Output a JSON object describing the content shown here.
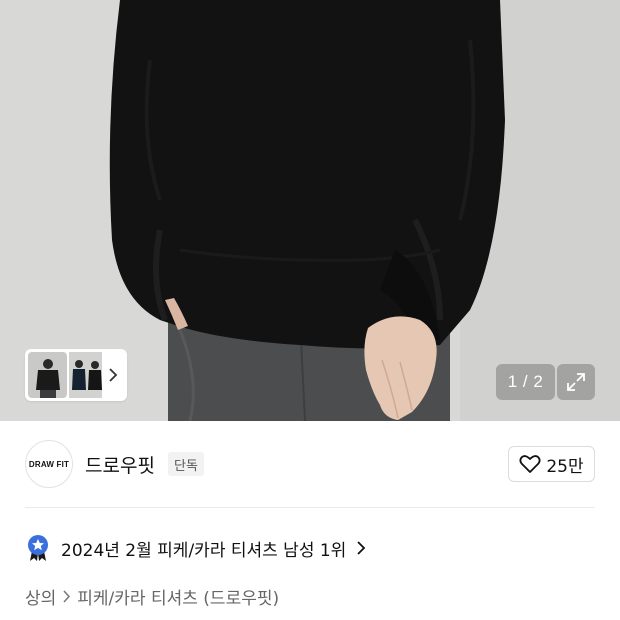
{
  "gallery": {
    "page_counter": "1 / 2",
    "thumbnail_count": 2
  },
  "brand": {
    "logo_text": "DRAW FIT",
    "name": "드로우핏",
    "badge": "단독"
  },
  "like": {
    "count": "25만"
  },
  "ranking": {
    "text": "2024년 2월 피케/카라 티셔츠 남성 1위"
  },
  "breadcrumb": {
    "items": [
      "상의",
      "피케/카라 티셔츠 (드로우핏)"
    ]
  },
  "colors": {
    "badge_blue": "#3a6fe0",
    "text_primary": "#111111",
    "text_secondary": "#666666"
  },
  "icons": {
    "like": "heart-outline-icon",
    "expand": "expand-arrows-icon",
    "rank": "ranking-medal-icon"
  }
}
